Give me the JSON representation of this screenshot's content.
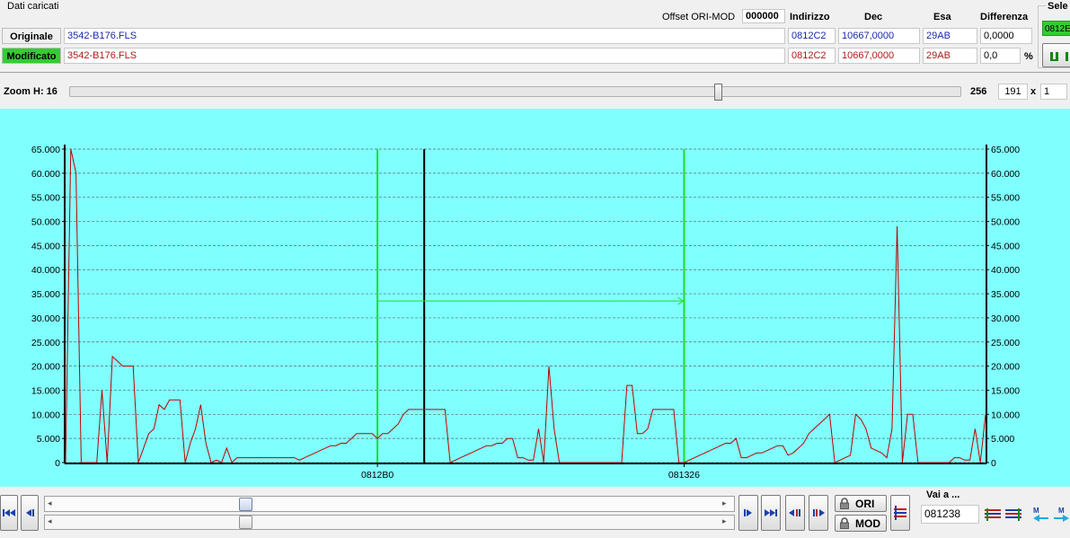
{
  "loaded_group": {
    "title": "Dati caricati",
    "offset_label": "Offset ORI-MOD",
    "offset_value": "000000",
    "col_headers": {
      "address": "Indirizzo",
      "dec": "Dec",
      "hex": "Esa",
      "diff": "Differenza"
    },
    "original": {
      "label": "Originale",
      "file": "3542-B176.FLS",
      "address": "0812C2",
      "dec": "10667,0000",
      "hex": "29AB",
      "diff": "0,0000"
    },
    "modified": {
      "label": "Modificato",
      "file": "3542-B176.FLS",
      "address": "0812C2",
      "dec": "10667,0000",
      "hex": "29AB",
      "diff": "0,0",
      "diff_unit": "%"
    }
  },
  "selection_group": {
    "title": "Sele",
    "value": "0812E"
  },
  "zoom": {
    "label": "Zoom H: 16",
    "level": 16,
    "max": "256",
    "width": "191",
    "times": "x",
    "height": "1"
  },
  "chart_data": {
    "type": "line",
    "ylim": [
      0,
      65000
    ],
    "y_ticks": [
      "65.000",
      "60.000",
      "55.000",
      "50.000",
      "45.000",
      "40.000",
      "35.000",
      "30.000",
      "25.000",
      "20.000",
      "15.000",
      "10.000",
      "5.000",
      "0"
    ],
    "y_tick_values": [
      65000,
      60000,
      55000,
      50000,
      45000,
      40000,
      35000,
      30000,
      25000,
      20000,
      15000,
      10000,
      5000,
      0
    ],
    "x_tick_labels": [
      "0812B0",
      "081326"
    ],
    "x_tick_index": [
      60,
      119
    ],
    "series": [
      {
        "color": "#c00000",
        "values": [
          0,
          65000,
          60000,
          0,
          0,
          0,
          0,
          15000,
          0,
          22000,
          21000,
          20000,
          20000,
          20000,
          0,
          3000,
          6000,
          7000,
          12000,
          11000,
          13000,
          13000,
          13000,
          0,
          4000,
          7000,
          12000,
          4000,
          0,
          500,
          0,
          3000,
          0,
          1000,
          1000,
          1000,
          1000,
          1000,
          1000,
          1000,
          1000,
          1000,
          1000,
          1000,
          1000,
          500,
          1000,
          1500,
          2000,
          2500,
          3000,
          3500,
          3500,
          4000,
          4000,
          5000,
          6000,
          6000,
          6000,
          6000,
          5000,
          6000,
          6000,
          7000,
          8000,
          10000,
          11000,
          11000,
          11000,
          11000,
          11000,
          11000,
          11000,
          11000,
          0,
          500,
          1000,
          1500,
          2000,
          2500,
          3000,
          3500,
          3500,
          4000,
          4000,
          5000,
          5000,
          1000,
          1000,
          500,
          500,
          7000,
          0,
          20000,
          7000,
          0,
          0,
          0,
          0,
          0,
          0,
          0,
          0,
          0,
          0,
          0,
          0,
          0,
          16000,
          16000,
          6000,
          6000,
          7000,
          11000,
          11000,
          11000,
          11000,
          11000,
          0,
          0,
          500,
          1000,
          1500,
          2000,
          2500,
          3000,
          3500,
          4000,
          4000,
          5000,
          1000,
          1000,
          1500,
          2000,
          2000,
          2500,
          3000,
          3500,
          3500,
          1500,
          2000,
          3000,
          4000,
          6000,
          7000,
          8000,
          9000,
          10000,
          0,
          500,
          1000,
          1500,
          10000,
          9000,
          7000,
          3000,
          2500,
          2000,
          1000,
          7000,
          49000,
          0,
          10000,
          10000,
          0,
          0,
          0,
          0,
          0,
          0,
          0,
          1000,
          1000,
          500,
          500,
          7000,
          0,
          10000
        ]
      }
    ],
    "markers": [
      {
        "type": "selection-start",
        "index": 60,
        "color": "#22dd22"
      },
      {
        "type": "selection-end",
        "index": 119,
        "color": "#22dd22"
      },
      {
        "type": "cursor",
        "index": 69,
        "color": "#000000"
      }
    ],
    "selection_arrow_value": 33500,
    "grid": true
  },
  "nav": {
    "ori_label": "ORI",
    "mod_label": "MOD",
    "goto_label": "Vai a ...",
    "goto_value": "081238",
    "h_scroll_position": 0.27,
    "v_scroll_position": 0.27
  }
}
